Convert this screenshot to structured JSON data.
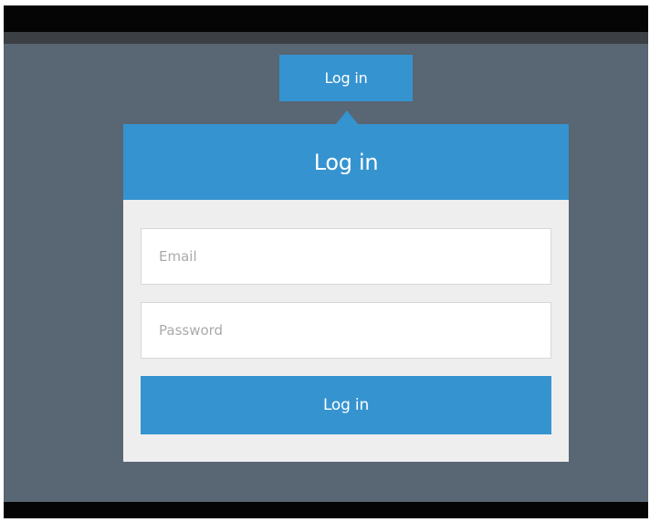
{
  "toggle": {
    "label": "Log in"
  },
  "login_panel": {
    "title": "Log in",
    "email": {
      "value": "",
      "placeholder": "Email"
    },
    "password": {
      "value": "",
      "placeholder": "Password"
    },
    "submit_label": "Log in"
  },
  "colors": {
    "accent": "#3593d0",
    "background": "#596673",
    "panel": "#eeeeee",
    "letterbox": "#050505"
  }
}
